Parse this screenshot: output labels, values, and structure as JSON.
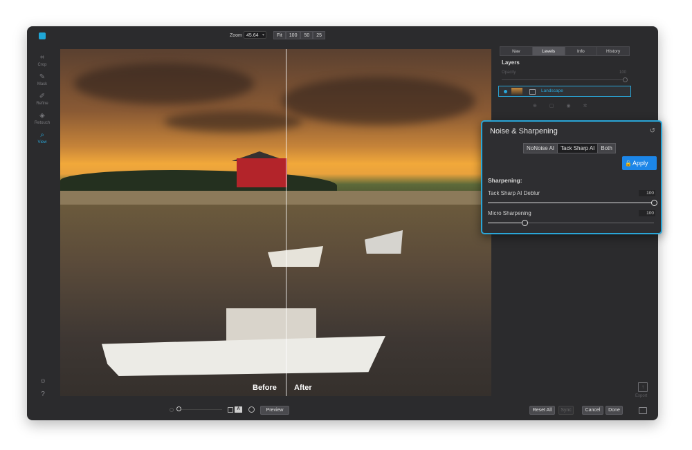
{
  "toolbar": {
    "zoom_label": "Zoom",
    "zoom_value": "45.64",
    "zoom_buttons": [
      "Fit",
      "100",
      "50",
      "25"
    ]
  },
  "left_tools": [
    {
      "label": "Crop",
      "icon": "crop-icon"
    },
    {
      "label": "Mask",
      "icon": "mask-icon"
    },
    {
      "label": "Refine",
      "icon": "refine-icon"
    },
    {
      "label": "Retouch",
      "icon": "retouch-icon"
    },
    {
      "label": "View",
      "icon": "view-icon",
      "active": true
    }
  ],
  "canvas": {
    "before_label": "Before",
    "after_label": "After"
  },
  "right_panel": {
    "tabs": [
      "Nav",
      "Levels",
      "Info",
      "History"
    ],
    "active_tab": "Levels",
    "layers_title": "Layers",
    "opacity_label": "Opacity",
    "opacity_value": "100",
    "layer_name": "Landscape"
  },
  "noise_panel": {
    "title": "Noise & Sharpening",
    "modes": [
      "NoNoise AI",
      "Tack Sharp AI",
      "Both"
    ],
    "active_mode": "Tack Sharp AI",
    "apply_label": "Apply",
    "section": "Sharpening:",
    "sliders": [
      {
        "label": "Tack Sharp AI Deblur",
        "value": "100",
        "fraction": 1.0
      },
      {
        "label": "Micro Sharpening",
        "value": "100",
        "fraction": 0.22
      }
    ]
  },
  "bottom_bar": {
    "view_mode_label": "A",
    "preview_label": "Preview",
    "reset_all_label": "Reset All",
    "sync_label": "Sync",
    "cancel_label": "Cancel",
    "done_label": "Done"
  },
  "export_label": "Export",
  "colors": {
    "accent": "#2aa6d8",
    "apply_button": "#1c86e8",
    "app_background": "#2b2b2d"
  }
}
